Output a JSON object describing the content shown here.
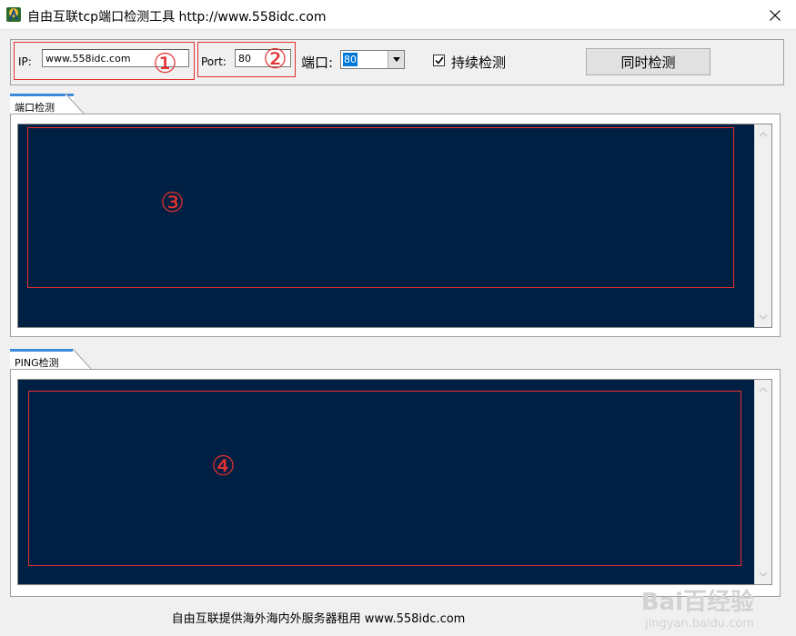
{
  "window": {
    "title": "自由互联tcp端口检测工具 http://www.558idc.com"
  },
  "toolbar": {
    "ip_label": "IP:",
    "ip_value": "www.558idc.com",
    "port_label": "Port:",
    "port_value": "80",
    "duankou_label": "端口:",
    "duankou_select": "80",
    "continuous_label": "持续检测",
    "continuous_checked": true,
    "detect_button": "同时检测",
    "marker_1": "①",
    "marker_2": "②"
  },
  "port_panel": {
    "tab_label": "端口检测",
    "marker": "③"
  },
  "ping_panel": {
    "tab_label": "PING检测",
    "marker": "④"
  },
  "footer": {
    "text": "自由互联提供海外海内外服务器租用 www.558idc.com"
  },
  "watermark": {
    "brand": "Bai百经验",
    "url": "jingyan.baidu.com"
  },
  "colors": {
    "console_bg": "#002043",
    "annotation_red": "#e53030",
    "tab_accent": "#3c8bd9",
    "selection": "#0078d7"
  }
}
